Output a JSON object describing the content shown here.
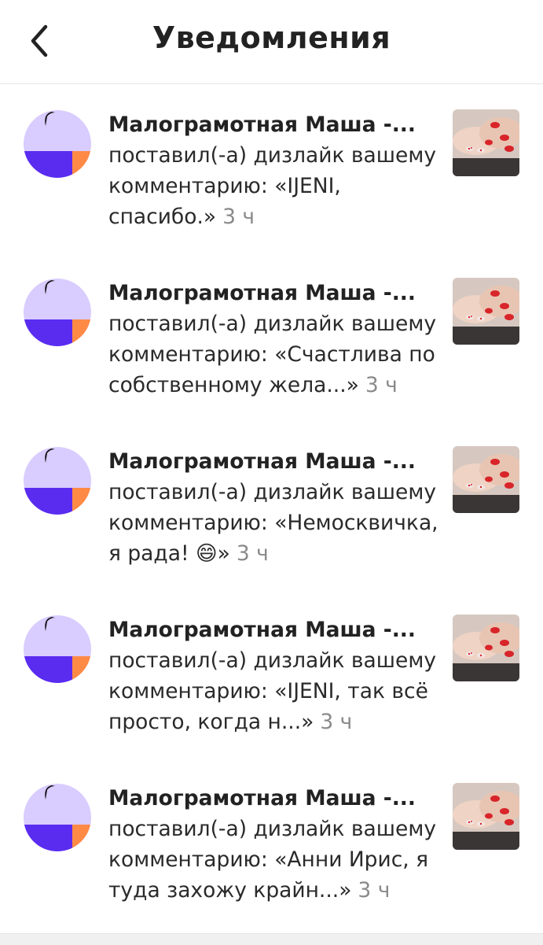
{
  "header": {
    "title": "Уведомления",
    "back_icon": "chevron-left-icon"
  },
  "notifications": [
    {
      "name": "Малограмотная Маша -...",
      "action": "поставил(-а) дизлайк вашему комментарию: «IJENI, спасибо.»",
      "time": "3 ч"
    },
    {
      "name": "Малограмотная Маша -...",
      "action": "поставил(-а) дизлайк вашему комментарию: «Счастлива по собственному жела...»",
      "time": "3 ч"
    },
    {
      "name": "Малограмотная Маша -...",
      "action": "поставил(-а) дизлайк вашему комментарию: «Немосквичка, я рада! 😄»",
      "time": "3 ч"
    },
    {
      "name": "Малограмотная Маша -...",
      "action": "поставил(-а) дизлайк вашему комментарию: «IJENI, так всё просто, когда н...»",
      "time": "3 ч"
    },
    {
      "name": "Малограмотная Маша -...",
      "action": "поставил(-а) дизлайк вашему комментарию: «Анни Ирис, я туда захожу крайн...»",
      "time": "3 ч"
    }
  ],
  "colors": {
    "avatar_light": "#d9ccff",
    "avatar_purple": "#5a2cf0",
    "avatar_orange": "#ff8a45",
    "nail_red": "#d8252a"
  }
}
